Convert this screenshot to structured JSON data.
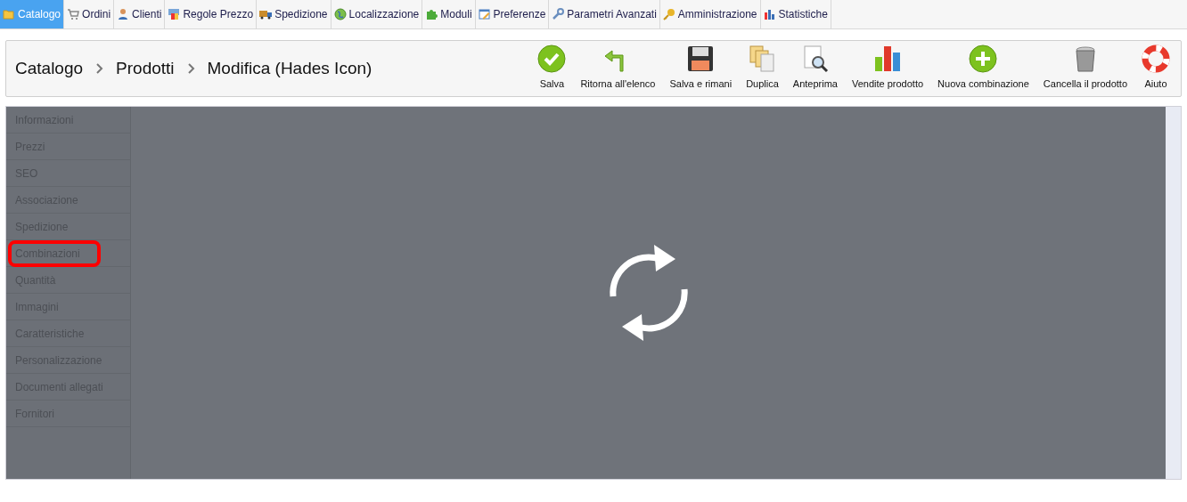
{
  "menu": [
    {
      "label": "Catalogo",
      "kind": "folder",
      "selected": true
    },
    {
      "label": "Ordini",
      "kind": "cart",
      "selected": false
    },
    {
      "label": "Clienti",
      "kind": "person",
      "selected": false
    },
    {
      "label": "Regole Prezzo",
      "kind": "price",
      "selected": false
    },
    {
      "label": "Spedizione",
      "kind": "truck",
      "selected": false
    },
    {
      "label": "Localizzazione",
      "kind": "globe",
      "selected": false
    },
    {
      "label": "Moduli",
      "kind": "puzzle",
      "selected": false
    },
    {
      "label": "Preferenze",
      "kind": "pencil",
      "selected": false
    },
    {
      "label": "Parametri Avanzati",
      "kind": "wrench",
      "selected": false
    },
    {
      "label": "Amministrazione",
      "kind": "key",
      "selected": false
    },
    {
      "label": "Statistiche",
      "kind": "chart",
      "selected": false
    }
  ],
  "breadcrumb": [
    "Catalogo",
    "Prodotti",
    "Modifica (Hades Icon)"
  ],
  "toolbar": [
    {
      "label": "Salva",
      "kind": "save-check"
    },
    {
      "label": "Ritorna all'elenco",
      "kind": "back"
    },
    {
      "label": "Salva e rimani",
      "kind": "disk"
    },
    {
      "label": "Duplica",
      "kind": "duplicate"
    },
    {
      "label": "Anteprima",
      "kind": "preview"
    },
    {
      "label": "Vendite prodotto",
      "kind": "sales"
    },
    {
      "label": "Nuova combinazione",
      "kind": "add"
    },
    {
      "label": "Cancella il prodotto",
      "kind": "trash"
    },
    {
      "label": "Aiuto",
      "kind": "help"
    }
  ],
  "tabs": [
    {
      "label": "Informazioni",
      "highlighted": false
    },
    {
      "label": "Prezzi",
      "highlighted": false
    },
    {
      "label": "SEO",
      "highlighted": false
    },
    {
      "label": "Associazione",
      "highlighted": false
    },
    {
      "label": "Spedizione",
      "highlighted": false
    },
    {
      "label": "Combinazioni",
      "highlighted": true
    },
    {
      "label": "Quantità",
      "highlighted": false
    },
    {
      "label": "Immagini",
      "highlighted": false
    },
    {
      "label": "Caratteristiche",
      "highlighted": false
    },
    {
      "label": "Personalizzazione",
      "highlighted": false
    },
    {
      "label": "Documenti allegati",
      "highlighted": false
    },
    {
      "label": "Fornitori",
      "highlighted": false
    }
  ],
  "loading": true
}
